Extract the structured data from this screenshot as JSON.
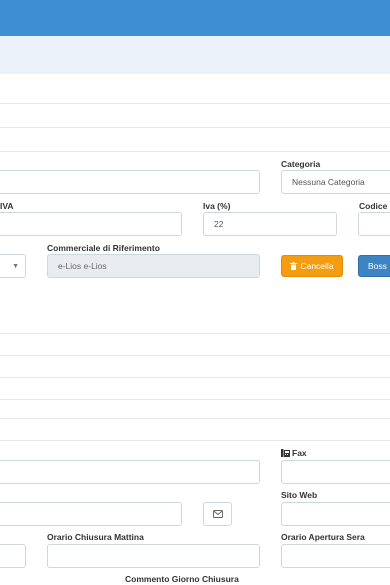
{
  "form": {
    "categoria": {
      "label": "Categoria",
      "value": "Nessuna Categoria"
    },
    "partita_iva": {
      "label": "IVA",
      "value": ""
    },
    "iva_percent": {
      "label": "Iva (%)",
      "value": "22"
    },
    "codice": {
      "label": "Codice",
      "value": ""
    },
    "commerciale": {
      "label": "Commerciale di Riferimento",
      "value": "e-Lios e-Lios"
    },
    "cancella_button": "Cancella",
    "boss_button": "Boss",
    "fax": {
      "label": "Fax",
      "value": ""
    },
    "sito_web": {
      "label": "Sito Web",
      "value": ""
    },
    "orario_chiusura_mattina": {
      "label": "Orario Chiusura Mattina",
      "value": ""
    },
    "orario_apertura_sera": {
      "label": "Orario Apertura Sera",
      "value": ""
    },
    "commento_giorno_chiusura": {
      "label": "Commento Giorno Chiusura"
    }
  },
  "icons": {
    "trash": "trash-icon",
    "fax": "fax-icon",
    "envelope": "envelope-icon",
    "dropdown": "caret-down-icon"
  },
  "colors": {
    "header": "#3e8fd1",
    "subheader": "#eaf1f9",
    "cancella": "#f59d12",
    "boss": "#3c84c4",
    "disabled_bg": "#e9ecef"
  }
}
